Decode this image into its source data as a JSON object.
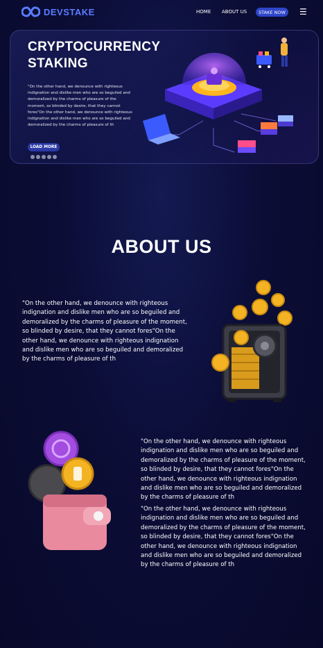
{
  "nav": {
    "brand": "DEVSTAKE",
    "home": "HOME",
    "about": "ABOUT US",
    "stake_button": "STAKE NOW",
    "menu_icon": "hamburger-menu-icon"
  },
  "hero": {
    "title": "CRYPTOCURRENCY STAKING",
    "text": "\"On the other hand, we denounce with righteous indignation and dislike men who are so beguiled and demoralized by the charms of pleasure of the moment, so blinded by desire, that they cannot fores\"On the other hand, we denounce with righteous indignation and dislike men who are so beguiled and demoralized by the charms of pleasure of th",
    "button": "LOAD MORE",
    "slides": 5,
    "active_slide": 1
  },
  "about": {
    "title": "ABOUT US",
    "para1": "\"On the other hand, we denounce with righteous indignation and dislike men who are so beguiled and demoralized by the charms of pleasure of the moment, so blinded by desire, that they cannot fores\"On the other hand, we denounce with righteous indignation and dislike men who are so beguiled and demoralized by the charms of pleasure of th",
    "para2": "\"On the other hand, we denounce with righteous indignation and dislike men who are so beguiled and demoralized by the charms of pleasure of the moment, so blinded by desire, that they cannot fores\"On the other hand, we denounce with righteous indignation and dislike men who are so beguiled and demoralized by the charms of pleasure of th",
    "para3": "\"On the other hand, we denounce with righteous indignation and dislike men who are so beguiled and demoralized by the charms of pleasure of the moment, so blinded by desire, that they cannot fores\"On the other hand, we denounce with righteous indignation and dislike men who are so beguiled and demoralized by the charms of pleasure of th"
  },
  "colors": {
    "background": "#0b0d36",
    "accent": "#2f45c9",
    "brand": "#5a7dff"
  }
}
